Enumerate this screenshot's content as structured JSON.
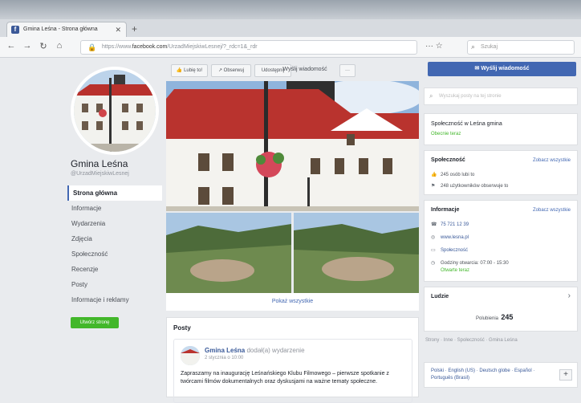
{
  "browser": {
    "tab_title": "Gmina Leśna - Strona główna",
    "url_host": "facebook.com",
    "url_prefix": "https://www.",
    "url_path": "/UrzadMiejskiwLesnej/?_rdc=1&_rdr",
    "search_placeholder": "Szukaj"
  },
  "sidebar": {
    "page_name": "Gmina Leśna",
    "handle": "@UrzadMiejskiwLesnej",
    "items": [
      {
        "label": "Strona główna"
      },
      {
        "label": "Informacje"
      },
      {
        "label": "Wydarzenia"
      },
      {
        "label": "Zdjęcia"
      },
      {
        "label": "Społeczność"
      },
      {
        "label": "Recenzje"
      },
      {
        "label": "Posty"
      },
      {
        "label": "Informacje i reklamy"
      }
    ],
    "create_button": "Utwórz stronę"
  },
  "actions": {
    "like": "Lubię to!",
    "follow": "Obserwuj",
    "share": "Udostępnij",
    "message": "Wyślij wiadomość",
    "more": "···"
  },
  "center": {
    "show_all": "Pokaż wszystkie",
    "posts_title": "Posty",
    "post": {
      "author": "Gmina Leśna",
      "action": "dodał(a) wydarzenie",
      "date": "2 stycznia o 10:00",
      "text": "Zapraszamy na inaugurację Leśnańskiego Klubu Filmowego – pierwsze spotkanie z twórcami filmów dokumentalnych oraz dyskusjami na ważne tematy społeczne."
    }
  },
  "right": {
    "send_button": "Wyślij wiadomość",
    "search_placeholder": "Wyszukaj posty na tej stronie",
    "community_card": {
      "title": "Społeczność w Leśna gmina",
      "status": "Obecnie teraz"
    },
    "community": {
      "title": "Społeczność",
      "see_all": "Zobacz wszystkie",
      "likes": "245 osób lubi to",
      "follows": "248 użytkowników obserwuje to"
    },
    "info": {
      "title": "Informacje",
      "see_all": "Zobacz wszystkie",
      "phone": "75 721 12 39",
      "website": "www.lesna.pl",
      "category": "Społeczność",
      "hours": "Godziny otwarcia: 07:00 - 15:30",
      "open_now": "Otwarte teraz"
    },
    "people": {
      "title": "Ludzie",
      "label": "Polubienia",
      "count": "245"
    },
    "footer": "Strony · Inne · Społeczność · Gmina Leśna",
    "languages": "Polski · English (US) · Deutsch globe · Español · Português (Brasil)",
    "plus": "+"
  }
}
